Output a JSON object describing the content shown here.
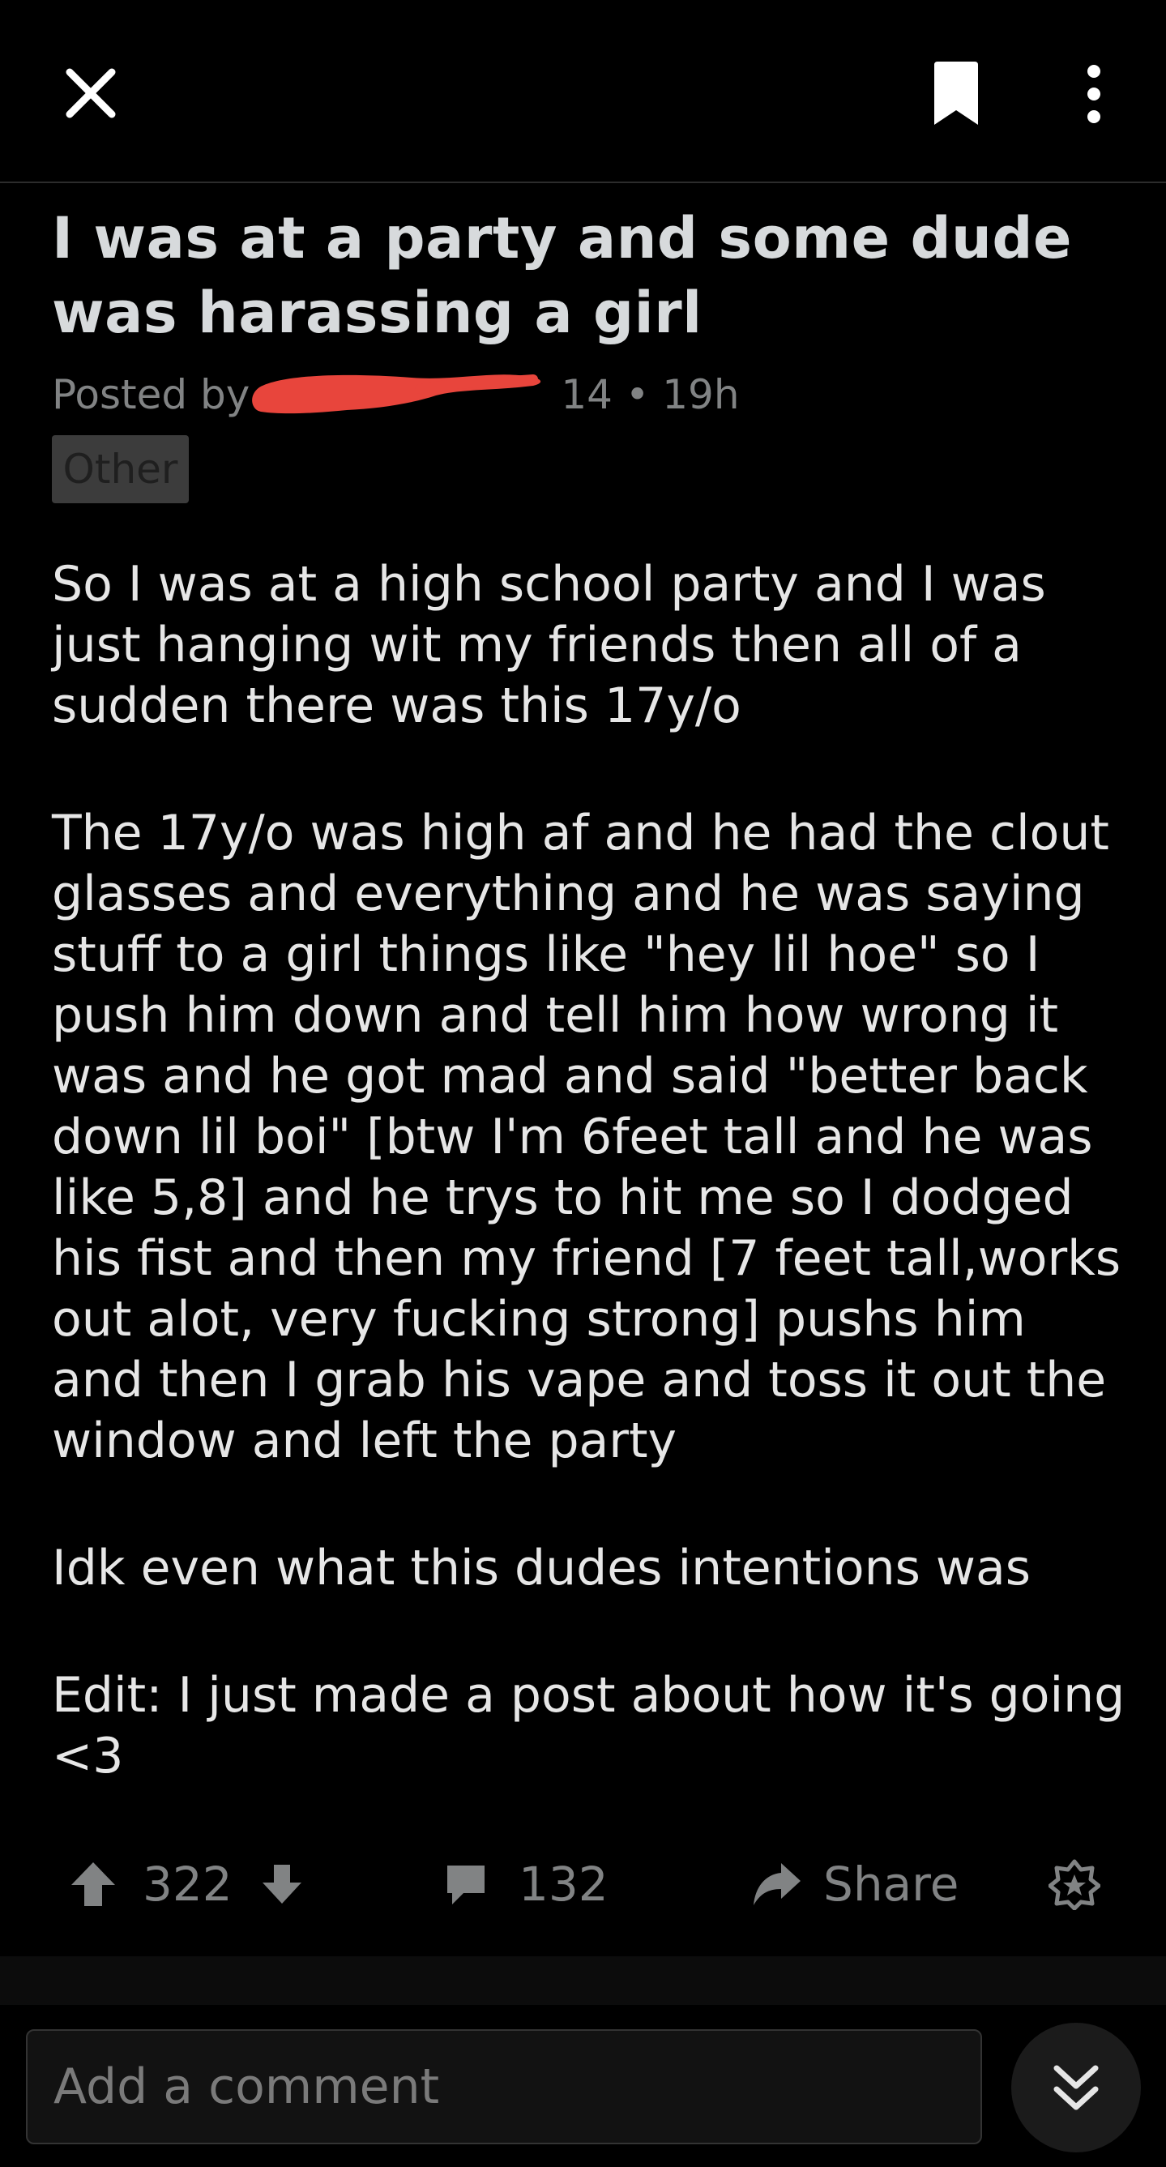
{
  "colors": {
    "background": "#000000",
    "title": "#d7dadc",
    "muted": "#818384",
    "body_text": "#e6e6e6",
    "redaction": "#e8453c"
  },
  "header": {
    "close_icon": "close-icon",
    "save_icon": "bookmark-icon",
    "more_icon": "more-vertical-icon"
  },
  "post": {
    "title": "I was at a party and some dude was harassing a girl",
    "meta_prefix": "Posted by",
    "meta_suffix": "14 • 19h",
    "flair": "Other",
    "paragraphs": [
      "So I was at a high school party and I was just hanging wit my friends then all of a sudden there was this 17y/o",
      "The 17y/o was high af and he had the clout glasses and everything and he was saying stuff to a girl things like \"hey lil hoe\" so I push him down and tell him how wrong it was and he got mad and said \"better back down lil boi\" [btw I'm 6feet tall and he was like 5,8] and he trys to hit me so I dodged his fist and then my friend [7 feet tall,works out alot, very fucking strong] pushs him and then I grab his vape and toss it out the window and left the party",
      "Idk even what this dudes intentions was",
      "Edit: I just made a post about how it's going <3"
    ]
  },
  "actions": {
    "upvote_icon": "upvote-arrow-icon",
    "score": "322",
    "downvote_icon": "downvote-arrow-icon",
    "comment_icon": "comment-bubble-icon",
    "comments": "132",
    "share_icon": "share-arrow-icon",
    "share_label": "Share",
    "award_icon": "award-icon"
  },
  "comment_bar": {
    "placeholder": "Add a comment",
    "jump_icon": "double-chevron-down-icon"
  }
}
